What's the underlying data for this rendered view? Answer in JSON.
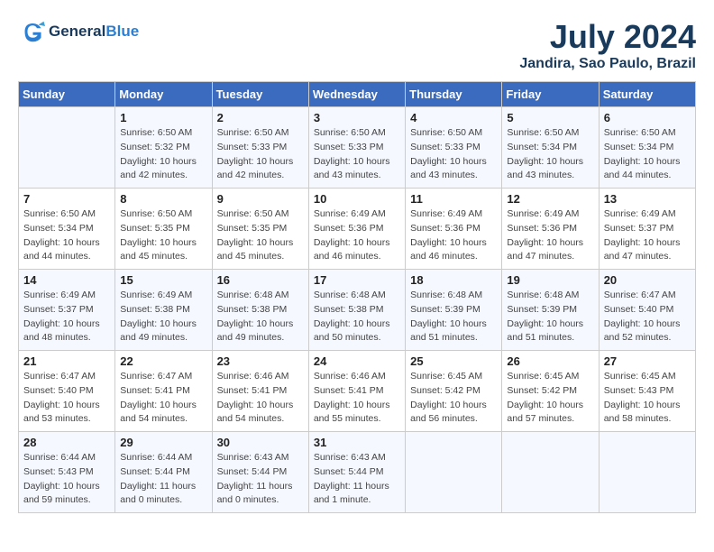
{
  "header": {
    "logo_line1": "General",
    "logo_line2": "Blue",
    "month_title": "July 2024",
    "location": "Jandira, Sao Paulo, Brazil"
  },
  "weekdays": [
    "Sunday",
    "Monday",
    "Tuesday",
    "Wednesday",
    "Thursday",
    "Friday",
    "Saturday"
  ],
  "weeks": [
    [
      {
        "day": "",
        "info": ""
      },
      {
        "day": "1",
        "info": "Sunrise: 6:50 AM\nSunset: 5:32 PM\nDaylight: 10 hours\nand 42 minutes."
      },
      {
        "day": "2",
        "info": "Sunrise: 6:50 AM\nSunset: 5:33 PM\nDaylight: 10 hours\nand 42 minutes."
      },
      {
        "day": "3",
        "info": "Sunrise: 6:50 AM\nSunset: 5:33 PM\nDaylight: 10 hours\nand 43 minutes."
      },
      {
        "day": "4",
        "info": "Sunrise: 6:50 AM\nSunset: 5:33 PM\nDaylight: 10 hours\nand 43 minutes."
      },
      {
        "day": "5",
        "info": "Sunrise: 6:50 AM\nSunset: 5:34 PM\nDaylight: 10 hours\nand 43 minutes."
      },
      {
        "day": "6",
        "info": "Sunrise: 6:50 AM\nSunset: 5:34 PM\nDaylight: 10 hours\nand 44 minutes."
      }
    ],
    [
      {
        "day": "7",
        "info": "Sunrise: 6:50 AM\nSunset: 5:34 PM\nDaylight: 10 hours\nand 44 minutes."
      },
      {
        "day": "8",
        "info": "Sunrise: 6:50 AM\nSunset: 5:35 PM\nDaylight: 10 hours\nand 45 minutes."
      },
      {
        "day": "9",
        "info": "Sunrise: 6:50 AM\nSunset: 5:35 PM\nDaylight: 10 hours\nand 45 minutes."
      },
      {
        "day": "10",
        "info": "Sunrise: 6:49 AM\nSunset: 5:36 PM\nDaylight: 10 hours\nand 46 minutes."
      },
      {
        "day": "11",
        "info": "Sunrise: 6:49 AM\nSunset: 5:36 PM\nDaylight: 10 hours\nand 46 minutes."
      },
      {
        "day": "12",
        "info": "Sunrise: 6:49 AM\nSunset: 5:36 PM\nDaylight: 10 hours\nand 47 minutes."
      },
      {
        "day": "13",
        "info": "Sunrise: 6:49 AM\nSunset: 5:37 PM\nDaylight: 10 hours\nand 47 minutes."
      }
    ],
    [
      {
        "day": "14",
        "info": "Sunrise: 6:49 AM\nSunset: 5:37 PM\nDaylight: 10 hours\nand 48 minutes."
      },
      {
        "day": "15",
        "info": "Sunrise: 6:49 AM\nSunset: 5:38 PM\nDaylight: 10 hours\nand 49 minutes."
      },
      {
        "day": "16",
        "info": "Sunrise: 6:48 AM\nSunset: 5:38 PM\nDaylight: 10 hours\nand 49 minutes."
      },
      {
        "day": "17",
        "info": "Sunrise: 6:48 AM\nSunset: 5:38 PM\nDaylight: 10 hours\nand 50 minutes."
      },
      {
        "day": "18",
        "info": "Sunrise: 6:48 AM\nSunset: 5:39 PM\nDaylight: 10 hours\nand 51 minutes."
      },
      {
        "day": "19",
        "info": "Sunrise: 6:48 AM\nSunset: 5:39 PM\nDaylight: 10 hours\nand 51 minutes."
      },
      {
        "day": "20",
        "info": "Sunrise: 6:47 AM\nSunset: 5:40 PM\nDaylight: 10 hours\nand 52 minutes."
      }
    ],
    [
      {
        "day": "21",
        "info": "Sunrise: 6:47 AM\nSunset: 5:40 PM\nDaylight: 10 hours\nand 53 minutes."
      },
      {
        "day": "22",
        "info": "Sunrise: 6:47 AM\nSunset: 5:41 PM\nDaylight: 10 hours\nand 54 minutes."
      },
      {
        "day": "23",
        "info": "Sunrise: 6:46 AM\nSunset: 5:41 PM\nDaylight: 10 hours\nand 54 minutes."
      },
      {
        "day": "24",
        "info": "Sunrise: 6:46 AM\nSunset: 5:41 PM\nDaylight: 10 hours\nand 55 minutes."
      },
      {
        "day": "25",
        "info": "Sunrise: 6:45 AM\nSunset: 5:42 PM\nDaylight: 10 hours\nand 56 minutes."
      },
      {
        "day": "26",
        "info": "Sunrise: 6:45 AM\nSunset: 5:42 PM\nDaylight: 10 hours\nand 57 minutes."
      },
      {
        "day": "27",
        "info": "Sunrise: 6:45 AM\nSunset: 5:43 PM\nDaylight: 10 hours\nand 58 minutes."
      }
    ],
    [
      {
        "day": "28",
        "info": "Sunrise: 6:44 AM\nSunset: 5:43 PM\nDaylight: 10 hours\nand 59 minutes."
      },
      {
        "day": "29",
        "info": "Sunrise: 6:44 AM\nSunset: 5:44 PM\nDaylight: 11 hours\nand 0 minutes."
      },
      {
        "day": "30",
        "info": "Sunrise: 6:43 AM\nSunset: 5:44 PM\nDaylight: 11 hours\nand 0 minutes."
      },
      {
        "day": "31",
        "info": "Sunrise: 6:43 AM\nSunset: 5:44 PM\nDaylight: 11 hours\nand 1 minute."
      },
      {
        "day": "",
        "info": ""
      },
      {
        "day": "",
        "info": ""
      },
      {
        "day": "",
        "info": ""
      }
    ]
  ]
}
